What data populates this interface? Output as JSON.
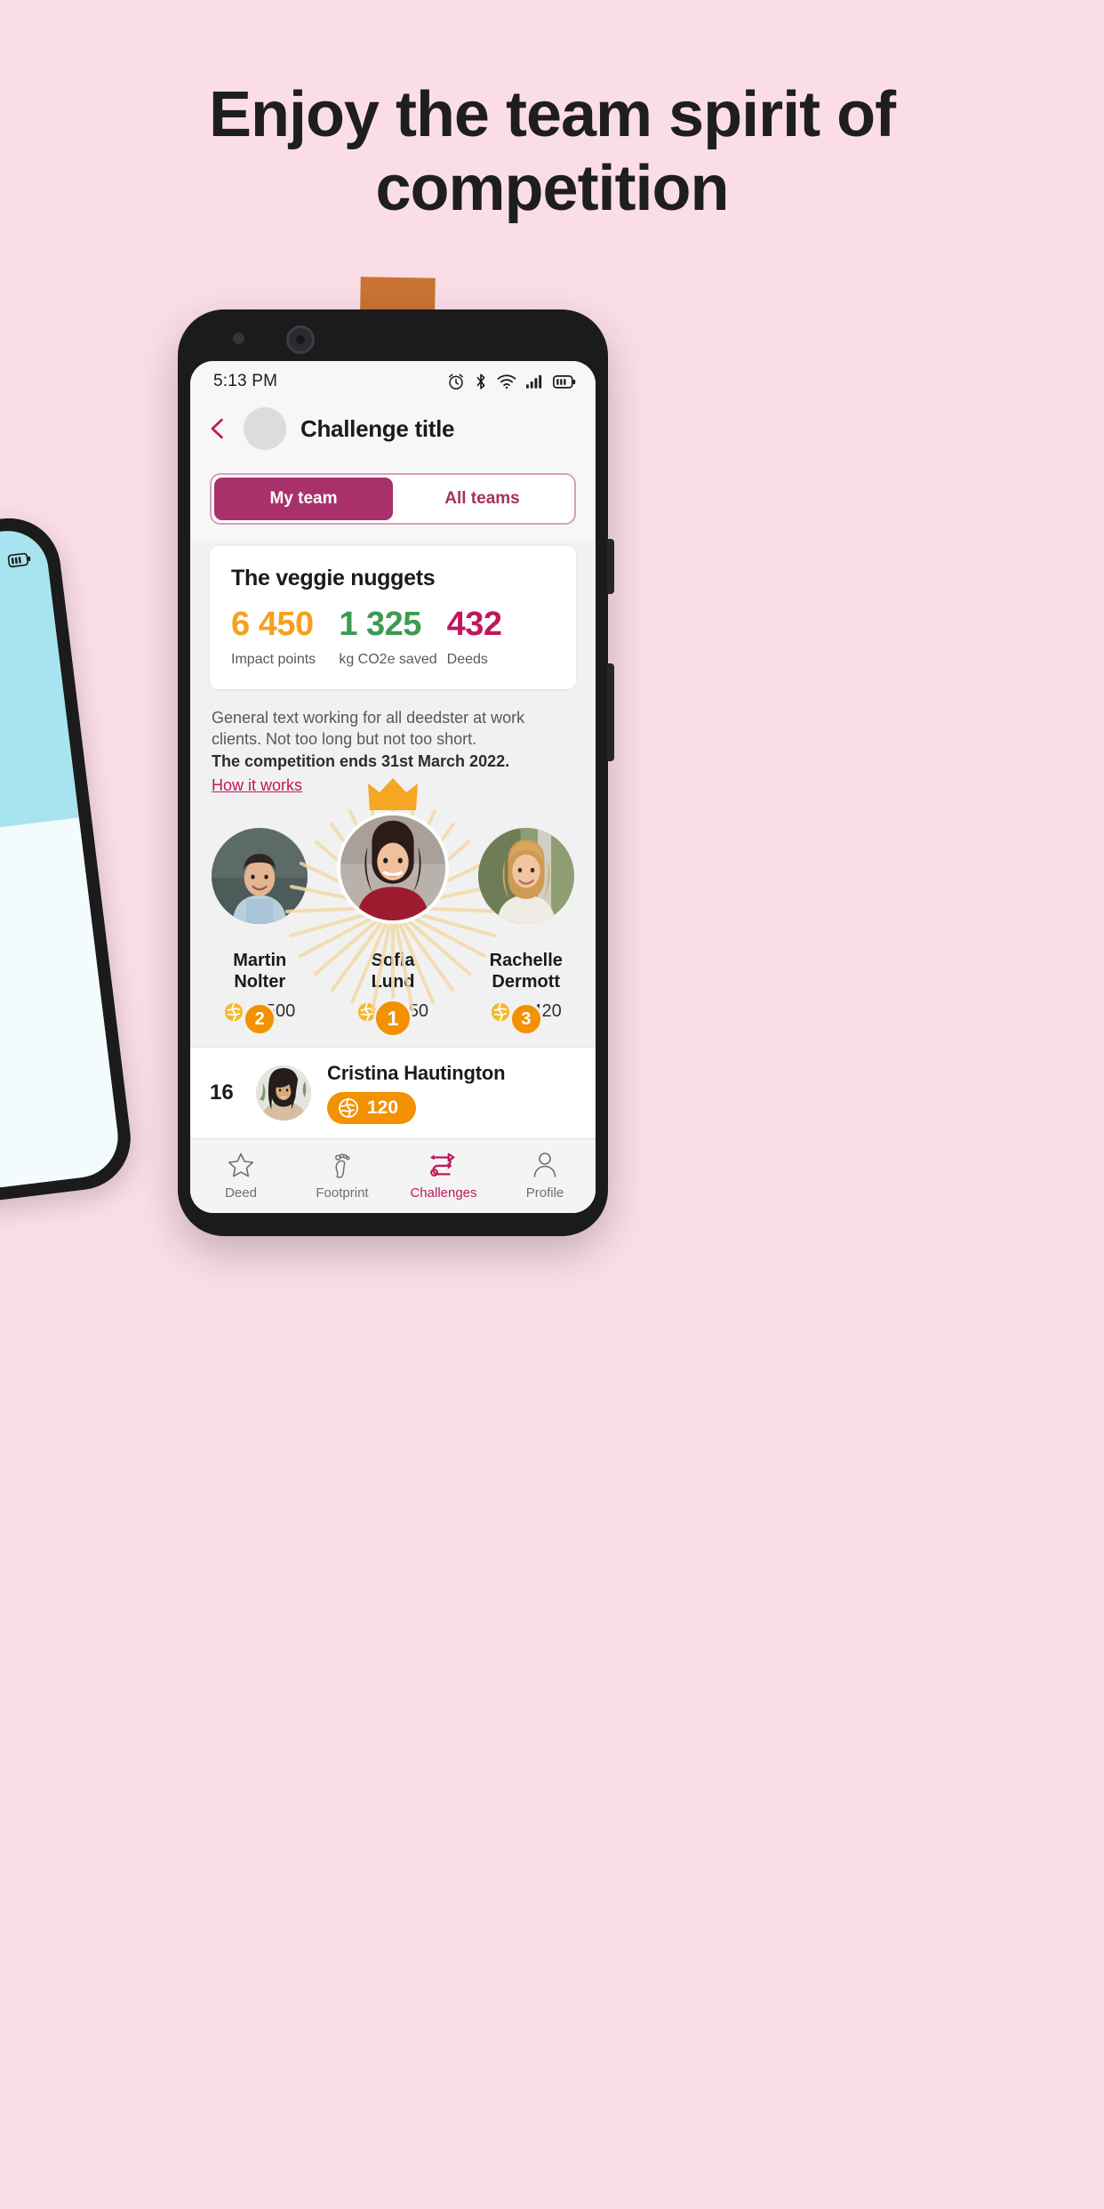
{
  "headline": "Enjoy the team spirit of competition",
  "status_bar": {
    "time": "5:13 PM",
    "icons": [
      "alarm-icon",
      "bluetooth-icon",
      "wifi-icon",
      "signal-icon",
      "battery-icon"
    ]
  },
  "header": {
    "back_icon": "chevron-left-icon",
    "avatar": "challenge-avatar",
    "title": "Challenge title"
  },
  "tabs": [
    {
      "label": "My team",
      "active": true
    },
    {
      "label": "All teams",
      "active": false
    }
  ],
  "stats_card": {
    "team_name": "The veggie nuggets",
    "stats": [
      {
        "value": "6 450",
        "label": "Impact points",
        "color": "#f5a01e"
      },
      {
        "value": "1 325",
        "label": "kg CO2e saved",
        "color": "#3d9b51"
      },
      {
        "value": "432",
        "label": "Deeds",
        "color": "#c0185c"
      }
    ]
  },
  "description": {
    "line1": "General text working for all deedster at work",
    "line2": "clients. Not too long but not too short.",
    "bold_line": "The competition ends 31st March 2022.",
    "link": "How it works"
  },
  "podium": [
    {
      "rank": "2",
      "first_name": "Martin",
      "last_name": "Nolter",
      "score": "1 500",
      "crown": false
    },
    {
      "rank": "1",
      "first_name": "Sofia",
      "last_name": "Lund",
      "score": "1 650",
      "crown": true
    },
    {
      "rank": "3",
      "first_name": "Rachelle",
      "last_name": "Dermott",
      "score": "1 420",
      "crown": false
    }
  ],
  "my_rank": {
    "position": "16",
    "name": "Cristina Hautington",
    "score": "120"
  },
  "bottom_nav": [
    {
      "label": "Deed",
      "icon": "star-icon",
      "active": false
    },
    {
      "label": "Footprint",
      "icon": "footprint-icon",
      "active": false
    },
    {
      "label": "Challenges",
      "icon": "challenges-icon",
      "active": true
    },
    {
      "label": "Profile",
      "icon": "person-icon",
      "active": false
    }
  ],
  "colors": {
    "background": "#fbdde6",
    "accent_pink": "#c0185c",
    "tab_active": "#a8316b",
    "orange": "#f39200",
    "green": "#3d9b51"
  }
}
